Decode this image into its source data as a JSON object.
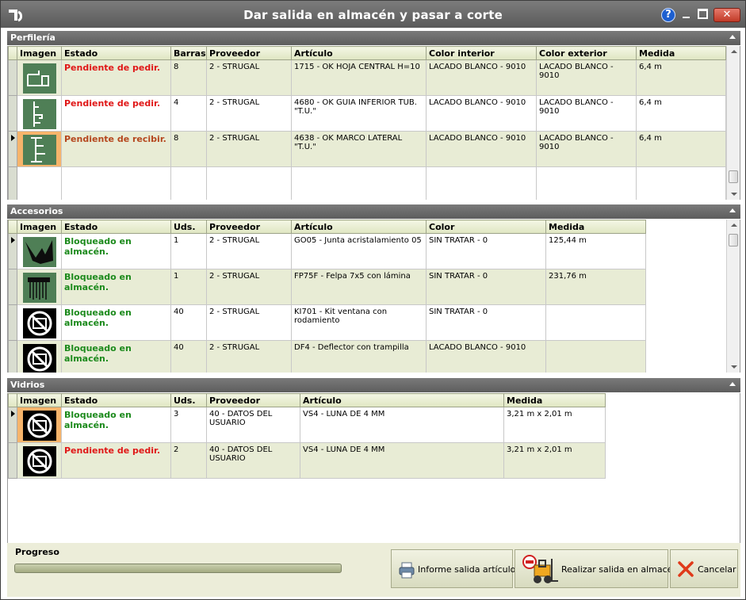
{
  "window": {
    "title": "Dar salida en almacén y pasar a corte",
    "help_label": "?",
    "close_label": "✕"
  },
  "colors": {
    "status_red": "#e01818",
    "status_brown": "#b5471e",
    "status_green": "#1c8a1c",
    "row_alt": "#e8ecd5",
    "selected_image": "#f6b46b",
    "header_bar": "#5d5d5d"
  },
  "perfileria": {
    "title": "Perfilería",
    "columns": [
      "Imagen",
      "Estado",
      "Barras",
      "Proveedor",
      "Artículo",
      "Color interior",
      "Color exterior",
      "Medida"
    ],
    "rows": [
      {
        "icon": "profile-sash-icon",
        "estado": "Pendiente de pedir.",
        "status": "red",
        "barras": "8",
        "proveedor": "2 - STRUGAL",
        "articulo": "1715 - OK HOJA CENTRAL H=10",
        "color_interior": "LACADO BLANCO - 9010",
        "color_exterior": "LACADO BLANCO - 9010",
        "medida": "6,4 m"
      },
      {
        "icon": "profile-guide-icon",
        "estado": "Pendiente de pedir.",
        "status": "red",
        "barras": "4",
        "proveedor": "2 - STRUGAL",
        "articulo": "4680 - OK GUIA INFERIOR TUB. \"T.U.\"",
        "color_interior": "LACADO BLANCO - 9010",
        "color_exterior": "LACADO BLANCO - 9010",
        "medida": "6,4 m"
      },
      {
        "icon": "profile-frame-icon",
        "estado": "Pendiente de recibir.",
        "status": "brown",
        "barras": "8",
        "proveedor": "2 - STRUGAL",
        "articulo": "4638 - OK MARCO LATERAL \"T.U.\"",
        "color_interior": "LACADO BLANCO - 9010",
        "color_exterior": "LACADO BLANCO - 9010",
        "medida": "6,4 m"
      }
    ]
  },
  "accesorios": {
    "title": "Accesorios",
    "columns": [
      "Imagen",
      "Estado",
      "Uds.",
      "Proveedor",
      "Artículo",
      "Color",
      "Medida"
    ],
    "rows": [
      {
        "icon": "gasket-icon",
        "estado": "Bloqueado en almacén.",
        "status": "green",
        "uds": "1",
        "proveedor": "2 - STRUGAL",
        "articulo": "GO05 - Junta acristalamiento 05",
        "color": "SIN TRATAR - 0",
        "medida": "125,44 m"
      },
      {
        "icon": "brush-seal-icon",
        "estado": "Bloqueado en almacén.",
        "status": "green",
        "uds": "1",
        "proveedor": "2 - STRUGAL",
        "articulo": "FP75F - Felpa 7x5 con lámina",
        "color": "SIN TRATAR - 0",
        "medida": "231,76 m"
      },
      {
        "icon": "no-image-icon",
        "estado": "Bloqueado en almacén.",
        "status": "green",
        "uds": "40",
        "proveedor": "2 - STRUGAL",
        "articulo": "KI701 - Kit ventana con rodamiento",
        "color": "SIN TRATAR - 0",
        "medida": ""
      },
      {
        "icon": "no-image-icon",
        "estado": "Bloqueado en almacén.",
        "status": "green",
        "uds": "40",
        "proveedor": "2 - STRUGAL",
        "articulo": "DF4 - Deflector con trampilla",
        "color": "LACADO BLANCO - 9010",
        "medida": ""
      }
    ]
  },
  "vidrios": {
    "title": "Vidrios",
    "columns": [
      "Imagen",
      "Estado",
      "Uds.",
      "Proveedor",
      "Artículo",
      "Medida"
    ],
    "rows": [
      {
        "icon": "no-image-icon",
        "estado": "Bloqueado en almacén.",
        "status": "green",
        "uds": "3",
        "proveedor": "40 - DATOS DEL USUARIO",
        "articulo": "VS4 - LUNA DE 4 MM",
        "medida": "3,21 m x 2,01 m"
      },
      {
        "icon": "no-image-icon",
        "estado": "Pendiente de pedir.",
        "status": "red",
        "uds": "2",
        "proveedor": "40 - DATOS DEL USUARIO",
        "articulo": "VS4 - LUNA DE 4 MM",
        "medida": "3,21 m x 2,01 m"
      }
    ]
  },
  "footer": {
    "progress_label": "Progreso",
    "progress_value": 0,
    "buttons": [
      {
        "label": "Informe salida artículos",
        "icon": "printer-icon"
      },
      {
        "label": "Realizar salida en almacén",
        "icon": "forklift-icon"
      },
      {
        "label": "Cancelar",
        "icon": "cancel-x-icon"
      }
    ]
  }
}
